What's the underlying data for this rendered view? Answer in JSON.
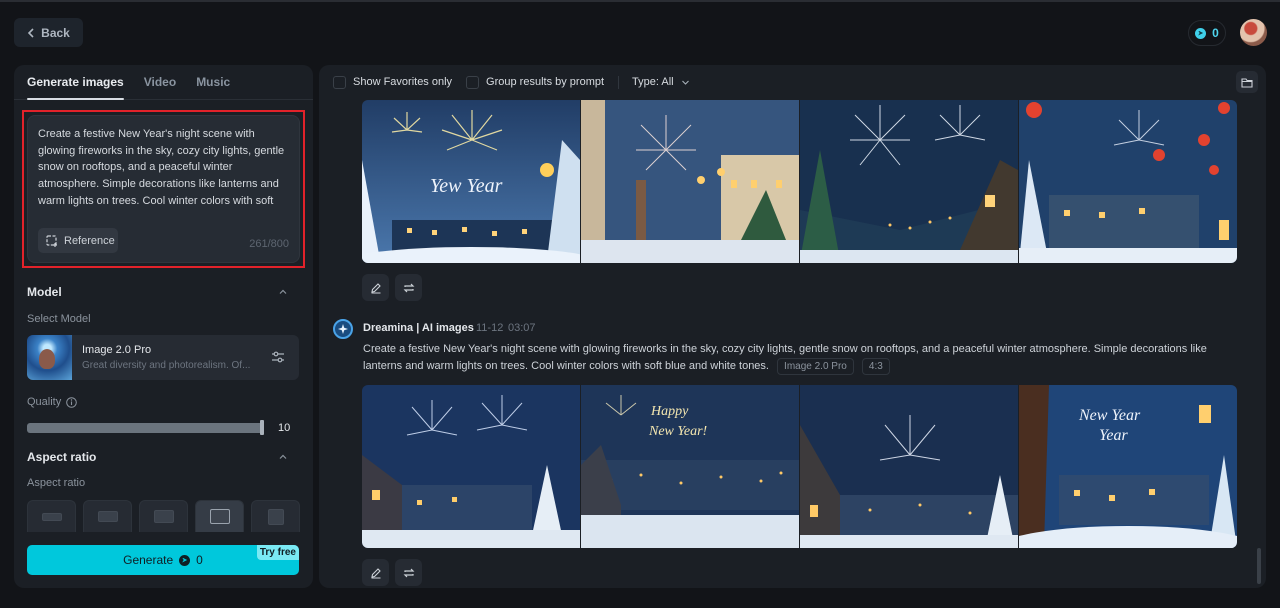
{
  "header": {
    "back_label": "Back",
    "credits": "0"
  },
  "left": {
    "tabs": [
      {
        "label": "Generate images",
        "active": true
      },
      {
        "label": "Video",
        "active": false
      },
      {
        "label": "Music",
        "active": false
      }
    ],
    "prompt": {
      "value": "Create a festive New Year's night scene with glowing fireworks in the sky, cozy city lights, gentle snow on rooftops, and a peaceful winter atmosphere. Simple decorations like lanterns and warm lights on trees. Cool winter colors with soft blue and white tones.",
      "reference_label": "Reference",
      "counter": "261/800"
    },
    "model": {
      "section_title": "Model",
      "select_label": "Select Model",
      "name": "Image 2.0 Pro",
      "description": "Great diversity and photorealism. Of..."
    },
    "quality": {
      "label": "Quality",
      "value": "10",
      "fraction": 1.0
    },
    "aspect": {
      "section_title": "Aspect ratio",
      "label": "Aspect ratio",
      "options": [
        {
          "name": "21:9",
          "active": false
        },
        {
          "name": "16:9",
          "active": false
        },
        {
          "name": "3:2",
          "active": false
        },
        {
          "name": "4:3",
          "active": true
        },
        {
          "name": "1:1",
          "active": false
        }
      ]
    },
    "generate": {
      "label": "Generate",
      "cost": "0",
      "badge": "Try free"
    }
  },
  "right": {
    "toolbar": {
      "favorites_label": "Show Favorites only",
      "group_label": "Group results by prompt",
      "type_label": "Type: All"
    },
    "generation": {
      "source": "Dreamina | AI images",
      "date": "11-12",
      "time": "03:07",
      "prompt": "Create a festive New Year's night scene with glowing fireworks in the sky, cozy city lights, gentle snow on rooftops, and a peaceful winter atmosphere. Simple decorations like lanterns and warm lights on trees. Cool winter colors with soft blue and white tones.",
      "model_chip": "Image 2.0 Pro",
      "ratio_chip": "4:3"
    },
    "images_top": [
      {
        "alt": "Illustrated snowy town with fireworks and 'Happy New Year' text"
      },
      {
        "alt": "Snowy street with lamps and fireworks over church tower"
      },
      {
        "alt": "Snowy village hillside with large fireworks"
      },
      {
        "alt": "Snowy houses with red lanterns and fireworks"
      }
    ],
    "images_bottom": [
      {
        "alt": "Snowy village street with blue fireworks"
      },
      {
        "alt": "Town view with 'Happy New Year' script in sky"
      },
      {
        "alt": "Snowy rooftops with fireworks over city"
      },
      {
        "alt": "Snow cabins with lantern and 'New Year' text"
      }
    ]
  }
}
